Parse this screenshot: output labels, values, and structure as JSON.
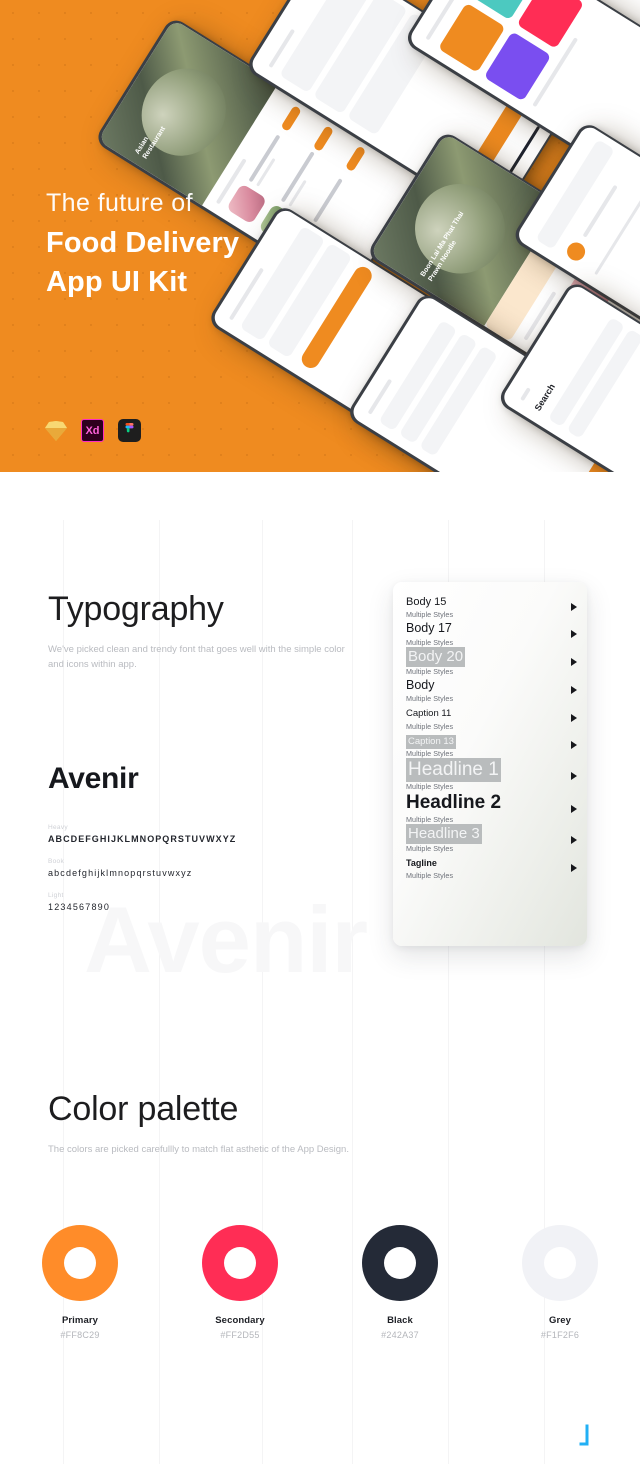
{
  "hero": {
    "subtitle": "The future of",
    "title_line1": "Food Delivery",
    "title_line2": "App UI Kit",
    "background_color": "#EF8B20",
    "tools": [
      {
        "name": "sketch-icon",
        "label": "Sketch"
      },
      {
        "name": "adobe-xd-icon",
        "label": "Xd"
      },
      {
        "name": "figma-icon",
        "label": "Figma"
      }
    ]
  },
  "typography": {
    "heading": "Typography",
    "description": "We've picked clean and trendy font that goes well with the simple color and icons within app.",
    "font_name": "Avenir",
    "watermark": "Avenir",
    "weights": [
      {
        "label": "Heavy",
        "sample": "ABCDEFGHIJKLMNOPQRSTUVWXYZ"
      },
      {
        "label": "Book",
        "sample": "abcdefghijklmnopqrstuvwxyz"
      },
      {
        "label": "Light",
        "sample": "1234567890"
      }
    ],
    "style_panel": {
      "subtitle_text": "Multiple Styles",
      "styles": [
        {
          "name": "Body 15",
          "size": 11,
          "weight": "normal",
          "highlighted": false
        },
        {
          "name": "Body 17",
          "size": 12.5,
          "weight": "normal",
          "highlighted": false
        },
        {
          "name": "Body 20",
          "size": 15,
          "weight": "normal",
          "highlighted": true
        },
        {
          "name": "Body",
          "size": 12.5,
          "weight": "normal",
          "highlighted": false
        },
        {
          "name": "Caption 11",
          "size": 9.5,
          "weight": "normal",
          "highlighted": false
        },
        {
          "name": "Caption 13",
          "size": 9.5,
          "weight": "normal",
          "highlighted": true
        },
        {
          "name": "Headline 1",
          "size": 19,
          "weight": "normal",
          "highlighted": true
        },
        {
          "name": "Headline 2",
          "size": 19,
          "weight": "bold",
          "highlighted": false
        },
        {
          "name": "Headline 3",
          "size": 15,
          "weight": "normal",
          "highlighted": true
        },
        {
          "name": "Tagline",
          "size": 9,
          "weight": "bold",
          "highlighted": false
        }
      ]
    }
  },
  "color_palette": {
    "heading": "Color palette",
    "description": "The colors are picked carefullly to match flat asthetic of the App Design.",
    "swatches": [
      {
        "name": "Primary",
        "hex": "#FF8C29"
      },
      {
        "name": "Secondary",
        "hex": "#FF2D55"
      },
      {
        "name": "Black",
        "hex": "#242A37"
      },
      {
        "name": "Grey",
        "hex": "#F1F2F6"
      }
    ]
  },
  "mockups": {
    "phone_screens": [
      "restaurant-list-screen",
      "menu-screen",
      "categories-screen",
      "checkout-screen",
      "dish-detail-screen",
      "profile-screen",
      "filter-screen",
      "search-screen"
    ],
    "visible_labels": [
      "Search"
    ]
  }
}
